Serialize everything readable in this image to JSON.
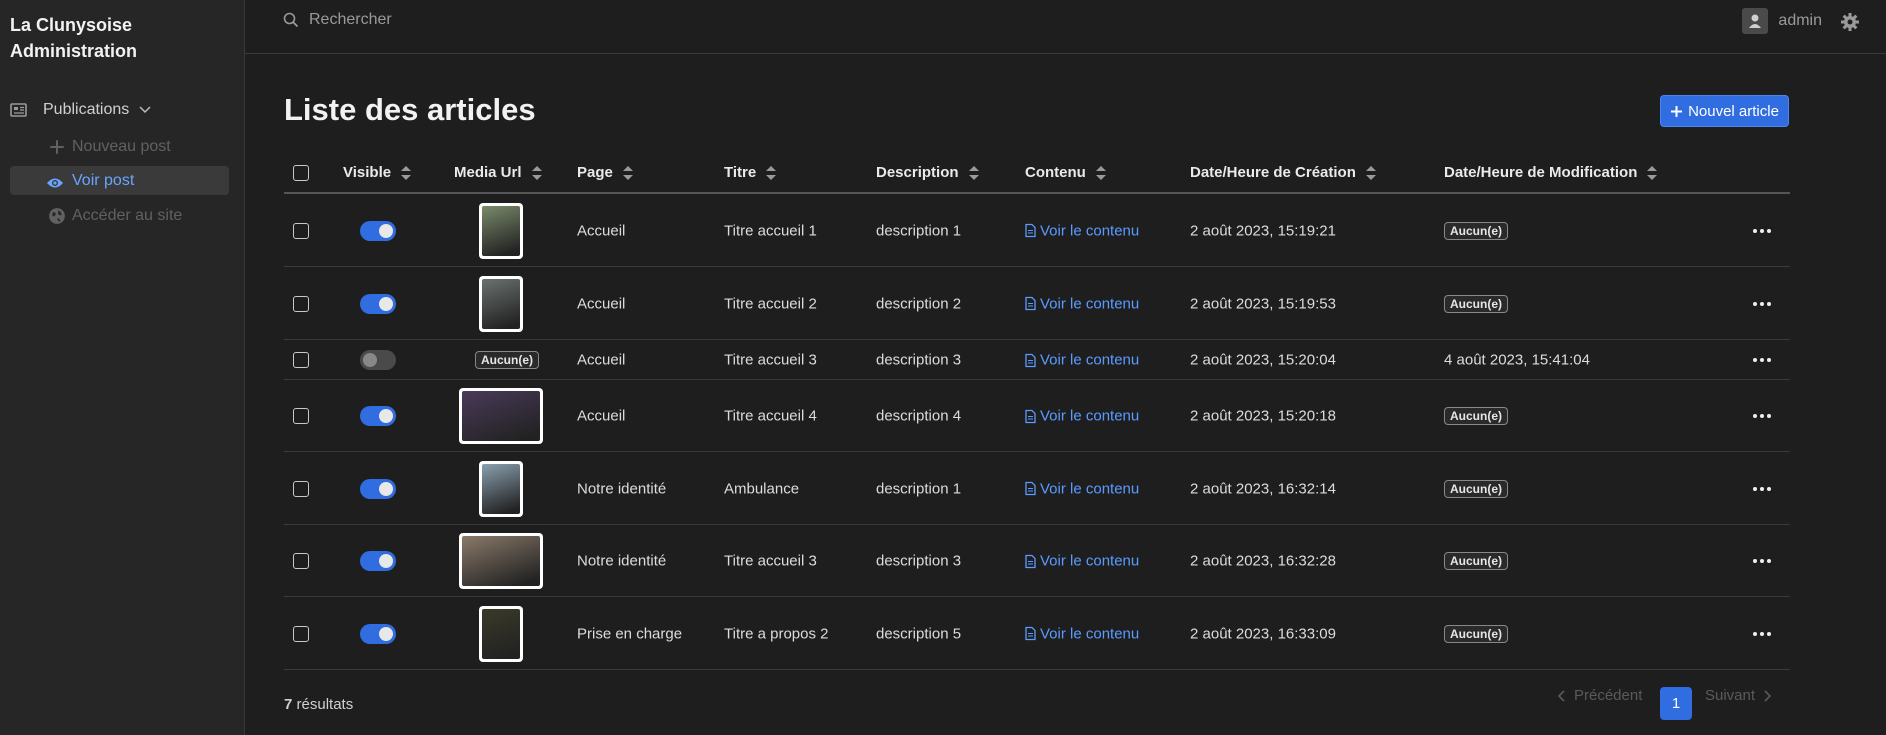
{
  "app": {
    "brand_line1": "La Clunysoise",
    "brand_line2": "Administration"
  },
  "sidebar": {
    "group_label": "Publications",
    "items": [
      {
        "label": "Nouveau post",
        "icon": "plus-icon",
        "state": "disabled"
      },
      {
        "label": "Voir post",
        "icon": "eye-icon",
        "state": "active"
      },
      {
        "label": "Accéder au site",
        "icon": "globe-icon",
        "state": "disabled"
      }
    ]
  },
  "topbar": {
    "search_placeholder": "Rechercher",
    "username": "admin"
  },
  "main": {
    "title": "Liste des articles",
    "new_button": "Nouvel article",
    "columns": [
      "Visible",
      "Media Url",
      "Page",
      "Titre",
      "Description",
      "Contenu",
      "Date/Heure de Création",
      "Date/Heure de Modification"
    ],
    "link_label": "Voir le contenu",
    "none_label": "Aucun(e)",
    "rows": [
      {
        "visible": true,
        "media": "portrait",
        "media_color": "#7a8a6a",
        "page": "Accueil",
        "title": "Titre accueil 1",
        "description": "description 1",
        "created": "2 août 2023, 15:19:21",
        "modified": ""
      },
      {
        "visible": true,
        "media": "portrait",
        "media_color": "#6a7270",
        "page": "Accueil",
        "title": "Titre accueil 2",
        "description": "description 2",
        "created": "2 août 2023, 15:19:53",
        "modified": ""
      },
      {
        "visible": false,
        "media": "",
        "media_color": "",
        "page": "Accueil",
        "title": "Titre accueil 3",
        "description": "description 3",
        "created": "2 août 2023, 15:20:04",
        "modified": "4 août 2023, 15:41:04"
      },
      {
        "visible": true,
        "media": "landscape",
        "media_color": "#4a3a5a",
        "page": "Accueil",
        "title": "Titre accueil 4",
        "description": "description 4",
        "created": "2 août 2023, 15:20:18",
        "modified": ""
      },
      {
        "visible": true,
        "media": "portrait",
        "media_color": "#8aa0b0",
        "page": "Notre identité",
        "title": "Ambulance",
        "description": "description 1",
        "created": "2 août 2023, 16:32:14",
        "modified": ""
      },
      {
        "visible": true,
        "media": "landscape",
        "media_color": "#8a7a6a",
        "page": "Notre identité",
        "title": "Titre accueil 3",
        "description": "description 3",
        "created": "2 août 2023, 16:32:28",
        "modified": ""
      },
      {
        "visible": true,
        "media": "portrait",
        "media_color": "#3a3a2a",
        "page": "Prise en charge",
        "title": "Titre a propos 2",
        "description": "description 5",
        "created": "2 août 2023, 16:33:09",
        "modified": ""
      }
    ]
  },
  "footer": {
    "count": "7",
    "count_suffix": " résultats",
    "prev_label": "Précédent",
    "next_label": "Suivant",
    "current_page": "1"
  },
  "colors": {
    "accent": "#2f6de1",
    "link": "#5a9bff",
    "background": "#1e1e1e",
    "sidebar": "#262626"
  }
}
